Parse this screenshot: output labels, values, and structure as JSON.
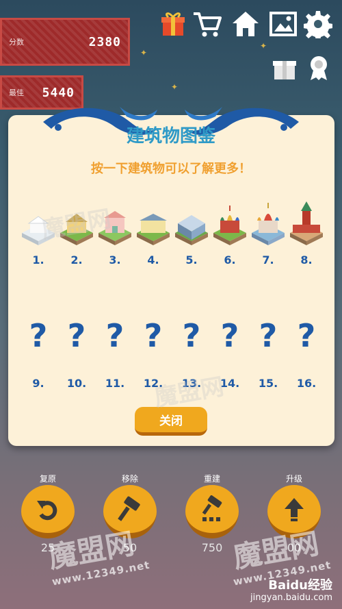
{
  "scores": {
    "score_label": "分数",
    "score_value": "2380",
    "best_label": "最佳",
    "best_value": "5440"
  },
  "top_icons": [
    "gift-icon",
    "cart-icon",
    "home-icon",
    "gallery-icon",
    "gear-icon"
  ],
  "side_icons": [
    "present-icon",
    "medal-icon"
  ],
  "modal": {
    "title": "建筑物图鉴",
    "subtitle": "按一下建筑物可以了解更多！",
    "unlocked": [
      {
        "num": "1.",
        "name": "snow-house"
      },
      {
        "num": "2.",
        "name": "yellow-house"
      },
      {
        "num": "3.",
        "name": "pink-mansion"
      },
      {
        "num": "4.",
        "name": "yellow-palace"
      },
      {
        "num": "5.",
        "name": "blue-building"
      },
      {
        "num": "6.",
        "name": "red-church"
      },
      {
        "num": "7.",
        "name": "onion-dome-cathedral"
      },
      {
        "num": "8.",
        "name": "red-tower"
      }
    ],
    "locked": [
      {
        "num": "9.",
        "mark": "?"
      },
      {
        "num": "10.",
        "mark": "?"
      },
      {
        "num": "11.",
        "mark": "?"
      },
      {
        "num": "12.",
        "mark": "?"
      },
      {
        "num": "13.",
        "mark": "?"
      },
      {
        "num": "14.",
        "mark": "?"
      },
      {
        "num": "15.",
        "mark": "?"
      },
      {
        "num": "16.",
        "mark": "?"
      }
    ],
    "close_label": "关闭"
  },
  "actions": [
    {
      "label": "复原",
      "cost": "25",
      "icon": "undo-icon"
    },
    {
      "label": "移除",
      "cost": "50",
      "icon": "hammer-icon"
    },
    {
      "label": "重建",
      "cost": "750",
      "icon": "rebuild-icon"
    },
    {
      "label": "升级",
      "cost": "00",
      "icon": "upgrade-arrow-icon"
    }
  ],
  "watermarks": {
    "brand": "魔盟网",
    "site": "www.12349.net",
    "baidu": "Baidu经验",
    "baidu_url": "jingyan.baidu.com"
  },
  "colors": {
    "accent_orange": "#f0a81e",
    "title_blue": "#2f9ac7",
    "number_blue": "#1f5aa6",
    "panel_red": "#9e2a2a"
  }
}
